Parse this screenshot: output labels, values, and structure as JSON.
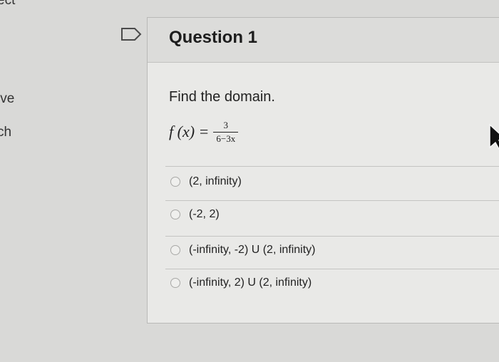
{
  "nav": {
    "items": [
      "ect",
      "ive",
      "ch"
    ]
  },
  "question": {
    "title": "Question 1",
    "prompt": "Find the domain.",
    "formula": {
      "lhs": "f (x) =",
      "numerator": "3",
      "denominator": "6−3x"
    },
    "options": [
      "(2, infinity)",
      "(-2, 2)",
      "(-infinity, -2) U (2, infinity)",
      "(-infinity, 2) U (2, infinity)"
    ]
  },
  "icons": {
    "flag": "flag-outline-icon",
    "cursor": "mouse-pointer-icon"
  }
}
